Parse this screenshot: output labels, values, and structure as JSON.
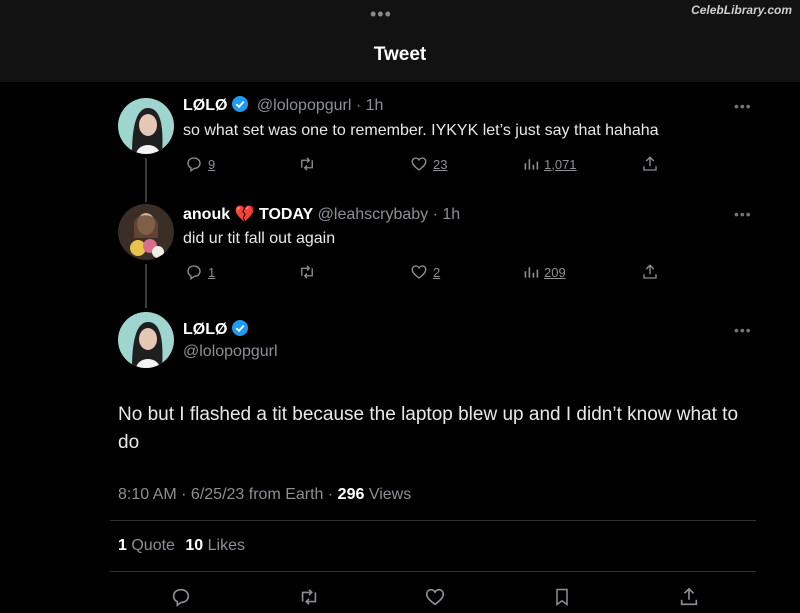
{
  "watermark": "CelebLibrary.com",
  "header": {
    "title": "Tweet",
    "more_icon": "ellipsis-icon"
  },
  "tweets": [
    {
      "name": "LØLØ",
      "handle": "@lolopopgurl",
      "time": "1h",
      "text": "so what set was one to remember. IYKYK let’s just say that hahaha",
      "replies": "9",
      "likes": "23",
      "views": "1,071",
      "verified": true
    },
    {
      "name": "anouk",
      "emoji": "💔",
      "name_suffix": "TODAY",
      "handle": "@leahscrybaby",
      "time": "1h",
      "text": "did ur tit fall out again",
      "replies": "1",
      "likes": "2",
      "views": "209"
    }
  ],
  "main_tweet": {
    "name": "LØLØ",
    "handle": "@lolopopgurl",
    "text": "No but I flashed a tit because the laptop blew up and I didn’t know what to do",
    "time": "8:10 AM",
    "date": "6/25/23",
    "source": "from Earth",
    "views_count": "296",
    "views_label": "Views",
    "quotes_count": "1",
    "quotes_label": "Quote",
    "likes_count": "10",
    "likes_label": "Likes"
  },
  "colors": {
    "background": "#000000",
    "header": "#121212",
    "verified": "#1d9bf0",
    "muted": "#8b9095"
  }
}
